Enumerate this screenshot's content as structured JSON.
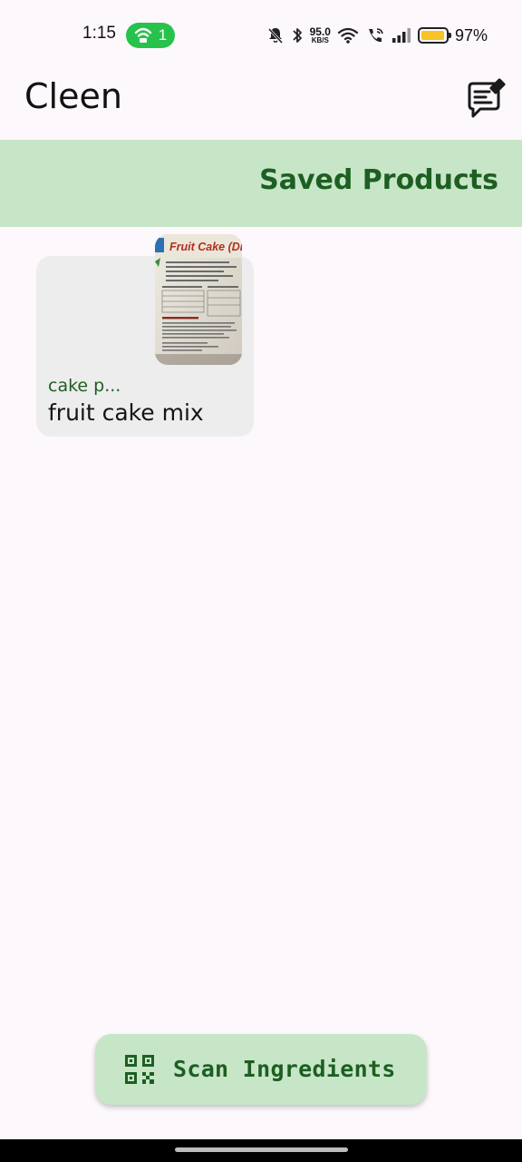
{
  "status_bar": {
    "time": "1:15",
    "hotspot_count": "1",
    "net_speed_value": "95.0",
    "net_speed_unit": "KB/S",
    "battery_percent": "97%",
    "battery_level": 0.97,
    "icons": [
      "hotspot-icon",
      "mute-icon",
      "bluetooth-icon",
      "wifi-icon",
      "wifi-calling-icon",
      "signal-icon",
      "battery-icon"
    ]
  },
  "app_bar": {
    "title": "Cleen",
    "feedback_icon": "feedback-edit-icon"
  },
  "section": {
    "title": "Saved Products"
  },
  "products": [
    {
      "category": "cake p...",
      "name": "fruit cake mix",
      "thumb_title": "Fruit Cake (Dry) M"
    }
  ],
  "scan_button": {
    "label": "Scan Ingredients",
    "icon": "qr-code-icon"
  },
  "colors": {
    "accent_green": "#1d5f22",
    "header_bg": "#c7e6c8",
    "card_bg": "#ededed",
    "page_bg": "#fdf8fc"
  }
}
